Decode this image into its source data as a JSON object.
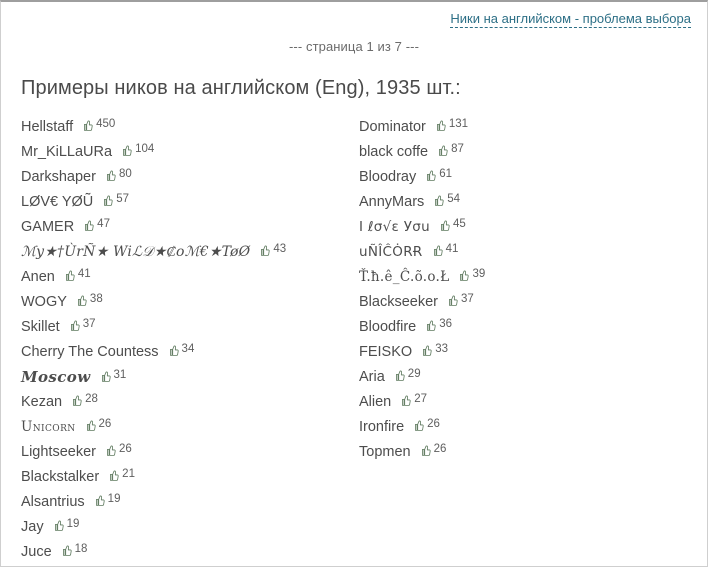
{
  "header": {
    "link_text": "Ники на английском - проблема выбора"
  },
  "page_counter": "--- страница 1 из 7 ---",
  "title": "Примеры ников на английском (Eng), 1935 шт.:",
  "icons": {
    "thumbs_up": "thumbs-up-icon"
  },
  "colors": {
    "link": "#2d6f86",
    "title": "#4a4a4a",
    "nick": "#4d4d4d",
    "count": "#5e5e5e",
    "icon": "#5f7a5f",
    "border": "#cfcfcf",
    "background": "#ffffff"
  },
  "columns": {
    "left": [
      {
        "name": "Hellstaff",
        "likes": "450",
        "style": "plain"
      },
      {
        "name": "Mr_KiLLaURa",
        "likes": "104",
        "style": "plain"
      },
      {
        "name": "Darkshaper",
        "likes": "80",
        "style": "plain"
      },
      {
        "name": "LØV€ YØŨ",
        "likes": "57",
        "style": "plain"
      },
      {
        "name": "GAMER",
        "likes": "47",
        "style": "plain"
      },
      {
        "name": "ℳy★†ÙrÑ★ Wiℒ𝒟★₡oℳ€★TøØ",
        "likes": "43",
        "style": "script"
      },
      {
        "name": "Anen",
        "likes": "41",
        "style": "plain"
      },
      {
        "name": "WOGY",
        "likes": "38",
        "style": "plain"
      },
      {
        "name": "Skillet",
        "likes": "37",
        "style": "plain"
      },
      {
        "name": "Cherry The Countess",
        "likes": "34",
        "style": "plain"
      },
      {
        "name": "Moscow",
        "likes": "31",
        "style": "serif-bold-italic"
      },
      {
        "name": "Kezan",
        "likes": "28",
        "style": "plain"
      },
      {
        "name": "Unicorn",
        "likes": "26",
        "style": "smallcaps"
      },
      {
        "name": "Lightseeker",
        "likes": "26",
        "style": "plain"
      },
      {
        "name": "Blackstalker",
        "likes": "21",
        "style": "plain"
      },
      {
        "name": "Alsantrius",
        "likes": "19",
        "style": "plain"
      },
      {
        "name": "Jay",
        "likes": "19",
        "style": "plain"
      },
      {
        "name": "Juce",
        "likes": "18",
        "style": "plain"
      }
    ],
    "right": [
      {
        "name": "Dominator",
        "likes": "131",
        "style": "plain"
      },
      {
        "name": "black coffe",
        "likes": "87",
        "style": "plain"
      },
      {
        "name": "Bloodray",
        "likes": "61",
        "style": "plain"
      },
      {
        "name": "AnnyMars",
        "likes": "54",
        "style": "plain"
      },
      {
        "name": "I ℓσ√ε Уσu",
        "likes": "45",
        "style": "unicode"
      },
      {
        "name": "uÑÎĈȮRɌ",
        "likes": "41",
        "style": "unicode"
      },
      {
        "name": "Ť.ħ.ê_Ĉ.õ.o.Ł",
        "likes": "39",
        "style": "mono-ish"
      },
      {
        "name": "Blackseeker",
        "likes": "37",
        "style": "plain"
      },
      {
        "name": "Bloodfire",
        "likes": "36",
        "style": "plain"
      },
      {
        "name": "FEISKO",
        "likes": "33",
        "style": "plain"
      },
      {
        "name": "Aria",
        "likes": "29",
        "style": "plain"
      },
      {
        "name": "Alien",
        "likes": "27",
        "style": "plain"
      },
      {
        "name": "Ironfire",
        "likes": "26",
        "style": "plain"
      },
      {
        "name": "Topmen",
        "likes": "26",
        "style": "plain"
      }
    ]
  }
}
